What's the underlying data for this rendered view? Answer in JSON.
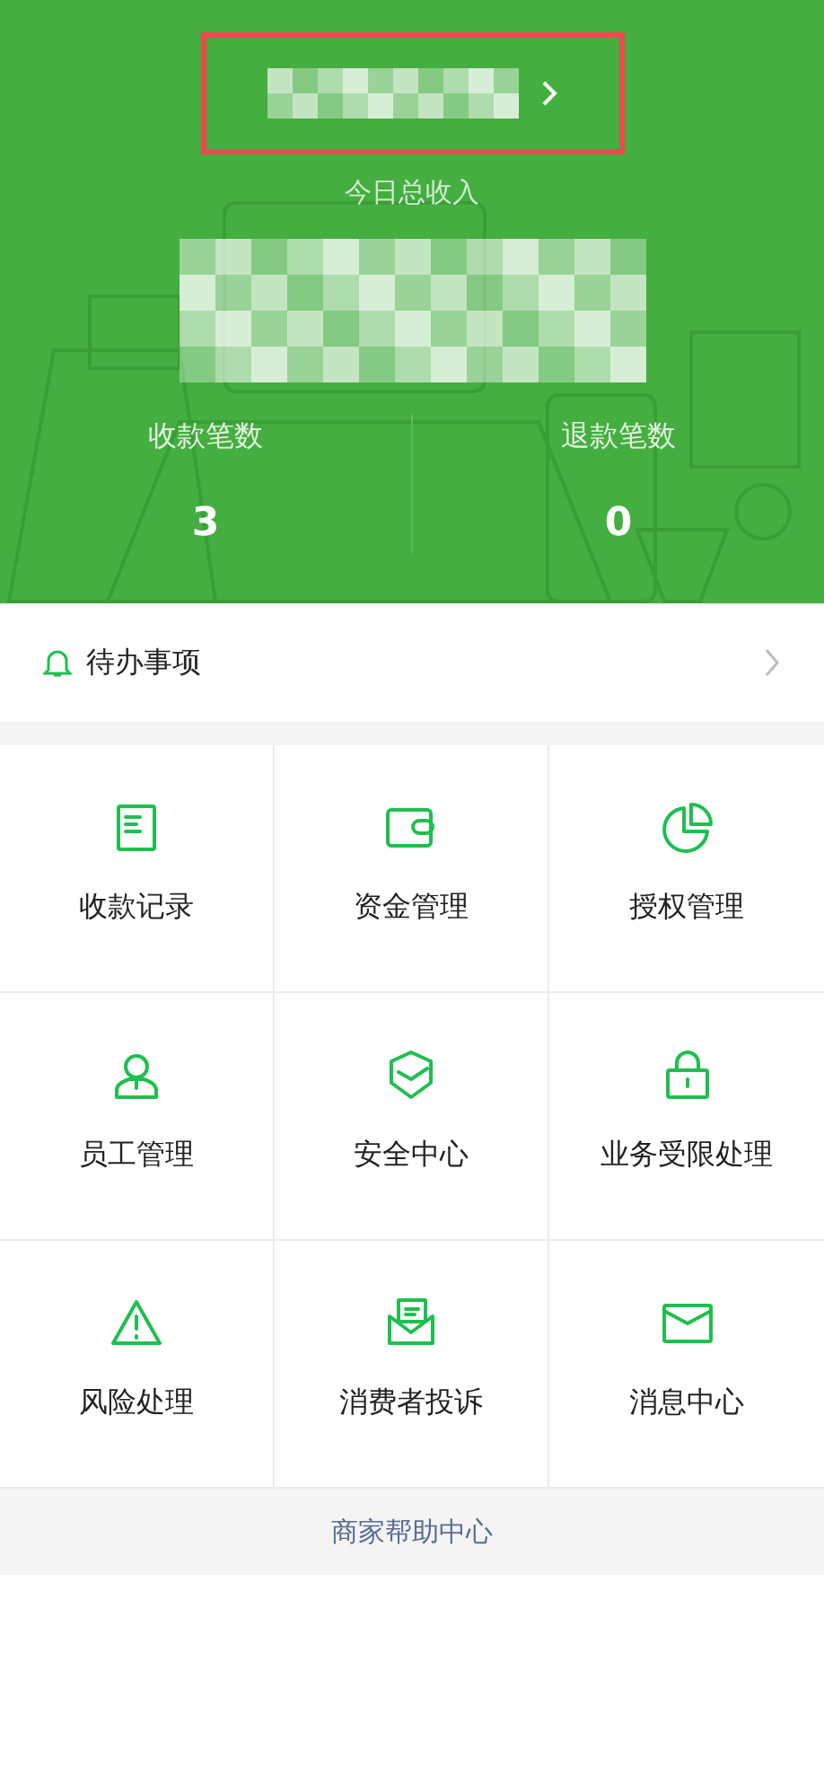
{
  "header": {
    "income_label": "今日总收入",
    "stats": [
      {
        "label": "收款笔数",
        "value": "3"
      },
      {
        "label": "退款笔数",
        "value": "0"
      }
    ]
  },
  "todo": {
    "label": "待办事项"
  },
  "grid": [
    {
      "label": "收款记录"
    },
    {
      "label": "资金管理"
    },
    {
      "label": "授权管理"
    },
    {
      "label": "员工管理"
    },
    {
      "label": "安全中心"
    },
    {
      "label": "业务受限处理"
    },
    {
      "label": "风险处理"
    },
    {
      "label": "消费者投诉"
    },
    {
      "label": "消息中心"
    }
  ],
  "footer": {
    "link": "商家帮助中心"
  }
}
